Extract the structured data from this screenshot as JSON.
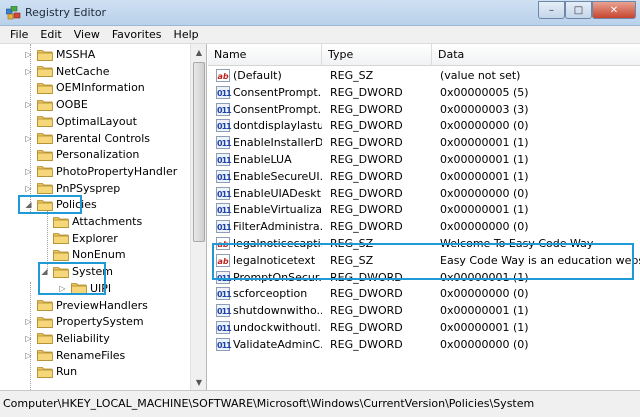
{
  "window": {
    "title": "Registry Editor",
    "controls": {
      "minimize": "–",
      "maximize": "□",
      "close": "✕"
    }
  },
  "menu": [
    "File",
    "Edit",
    "View",
    "Favorites",
    "Help"
  ],
  "tree": [
    {
      "label": "MSSHA",
      "level": 0,
      "expander": "▷"
    },
    {
      "label": "NetCache",
      "level": 0,
      "expander": "▷"
    },
    {
      "label": "OEMInformation",
      "level": 0,
      "expander": ""
    },
    {
      "label": "OOBE",
      "level": 0,
      "expander": "▷"
    },
    {
      "label": "OptimalLayout",
      "level": 0,
      "expander": ""
    },
    {
      "label": "Parental Controls",
      "level": 0,
      "expander": "▷"
    },
    {
      "label": "Personalization",
      "level": 0,
      "expander": ""
    },
    {
      "label": "PhotoPropertyHandler",
      "level": 0,
      "expander": "▷"
    },
    {
      "label": "PnPSysprep",
      "level": 0,
      "expander": "▷"
    },
    {
      "label": "Policies",
      "level": 0,
      "expander": "◢"
    },
    {
      "label": "Attachments",
      "level": 1,
      "expander": ""
    },
    {
      "label": "Explorer",
      "level": 1,
      "expander": ""
    },
    {
      "label": "NonEnum",
      "level": 1,
      "expander": ""
    },
    {
      "label": "System",
      "level": 1,
      "expander": "◢"
    },
    {
      "label": "UIPI",
      "level": 2,
      "expander": "▷"
    },
    {
      "label": "PreviewHandlers",
      "level": 0,
      "expander": ""
    },
    {
      "label": "PropertySystem",
      "level": 0,
      "expander": "▷"
    },
    {
      "label": "Reliability",
      "level": 0,
      "expander": "▷"
    },
    {
      "label": "RenameFiles",
      "level": 0,
      "expander": "▷"
    },
    {
      "label": "Run",
      "level": 0,
      "expander": ""
    }
  ],
  "columns": {
    "name": "Name",
    "type": "Type",
    "data": "Data"
  },
  "values": [
    {
      "icon": "ab",
      "name": "(Default)",
      "type": "REG_SZ",
      "data": "(value not set)"
    },
    {
      "icon": "011",
      "name": "ConsentPrompt...",
      "type": "REG_DWORD",
      "data": "0x00000005 (5)"
    },
    {
      "icon": "011",
      "name": "ConsentPrompt...",
      "type": "REG_DWORD",
      "data": "0x00000003 (3)"
    },
    {
      "icon": "011",
      "name": "dontdisplaylastu...",
      "type": "REG_DWORD",
      "data": "0x00000000 (0)"
    },
    {
      "icon": "011",
      "name": "EnableInstallerD...",
      "type": "REG_DWORD",
      "data": "0x00000001 (1)"
    },
    {
      "icon": "011",
      "name": "EnableLUA",
      "type": "REG_DWORD",
      "data": "0x00000001 (1)"
    },
    {
      "icon": "011",
      "name": "EnableSecureUI...",
      "type": "REG_DWORD",
      "data": "0x00000001 (1)"
    },
    {
      "icon": "011",
      "name": "EnableUIADeskt...",
      "type": "REG_DWORD",
      "data": "0x00000000 (0)"
    },
    {
      "icon": "011",
      "name": "EnableVirtualizat...",
      "type": "REG_DWORD",
      "data": "0x00000001 (1)"
    },
    {
      "icon": "011",
      "name": "FilterAdministra...",
      "type": "REG_DWORD",
      "data": "0x00000000 (0)"
    },
    {
      "icon": "ab",
      "name": "legalnoticecapti...",
      "type": "REG_SZ",
      "data": "Welcome To Easy Code Way"
    },
    {
      "icon": "ab",
      "name": "legalnoticetext",
      "type": "REG_SZ",
      "data": "Easy Code Way is an education website"
    },
    {
      "icon": "011",
      "name": "PromptOnSecur...",
      "type": "REG_DWORD",
      "data": "0x00000001 (1)"
    },
    {
      "icon": "011",
      "name": "scforceoption",
      "type": "REG_DWORD",
      "data": "0x00000000 (0)"
    },
    {
      "icon": "011",
      "name": "shutdownwitho...",
      "type": "REG_DWORD",
      "data": "0x00000001 (1)"
    },
    {
      "icon": "011",
      "name": "undockwithoutl...",
      "type": "REG_DWORD",
      "data": "0x00000001 (1)"
    },
    {
      "icon": "011",
      "name": "ValidateAdminC...",
      "type": "REG_DWORD",
      "data": "0x00000000 (0)"
    }
  ],
  "status": {
    "path": "Computer\\HKEY_LOCAL_MACHINE\\SOFTWARE\\Microsoft\\Windows\\CurrentVersion\\Policies\\System"
  },
  "colors": {
    "highlight": "#1f9ad6",
    "folder": "#e8c25a"
  }
}
